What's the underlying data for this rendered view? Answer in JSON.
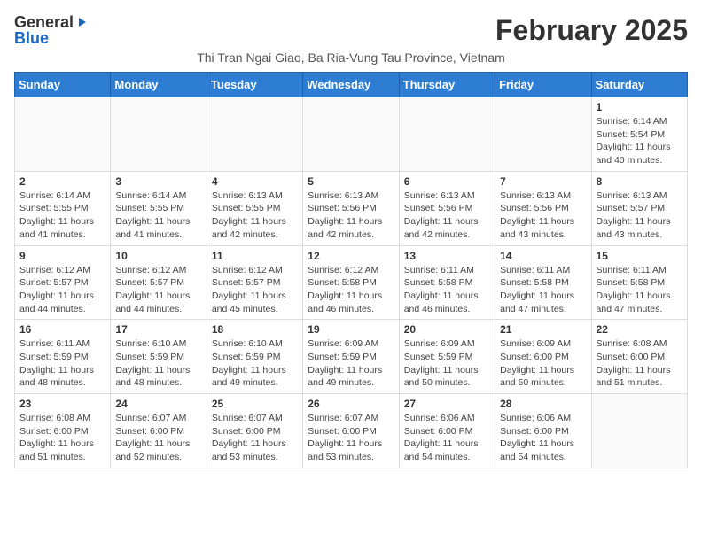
{
  "logo": {
    "general": "General",
    "blue": "Blue",
    "icon": "▶"
  },
  "title": "February 2025",
  "subtitle": "Thi Tran Ngai Giao, Ba Ria-Vung Tau Province, Vietnam",
  "days_of_week": [
    "Sunday",
    "Monday",
    "Tuesday",
    "Wednesday",
    "Thursday",
    "Friday",
    "Saturday"
  ],
  "weeks": [
    [
      {
        "num": "",
        "info": ""
      },
      {
        "num": "",
        "info": ""
      },
      {
        "num": "",
        "info": ""
      },
      {
        "num": "",
        "info": ""
      },
      {
        "num": "",
        "info": ""
      },
      {
        "num": "",
        "info": ""
      },
      {
        "num": "1",
        "info": "Sunrise: 6:14 AM\nSunset: 5:54 PM\nDaylight: 11 hours\nand 40 minutes."
      }
    ],
    [
      {
        "num": "2",
        "info": "Sunrise: 6:14 AM\nSunset: 5:55 PM\nDaylight: 11 hours\nand 41 minutes."
      },
      {
        "num": "3",
        "info": "Sunrise: 6:14 AM\nSunset: 5:55 PM\nDaylight: 11 hours\nand 41 minutes."
      },
      {
        "num": "4",
        "info": "Sunrise: 6:13 AM\nSunset: 5:55 PM\nDaylight: 11 hours\nand 42 minutes."
      },
      {
        "num": "5",
        "info": "Sunrise: 6:13 AM\nSunset: 5:56 PM\nDaylight: 11 hours\nand 42 minutes."
      },
      {
        "num": "6",
        "info": "Sunrise: 6:13 AM\nSunset: 5:56 PM\nDaylight: 11 hours\nand 42 minutes."
      },
      {
        "num": "7",
        "info": "Sunrise: 6:13 AM\nSunset: 5:56 PM\nDaylight: 11 hours\nand 43 minutes."
      },
      {
        "num": "8",
        "info": "Sunrise: 6:13 AM\nSunset: 5:57 PM\nDaylight: 11 hours\nand 43 minutes."
      }
    ],
    [
      {
        "num": "9",
        "info": "Sunrise: 6:12 AM\nSunset: 5:57 PM\nDaylight: 11 hours\nand 44 minutes."
      },
      {
        "num": "10",
        "info": "Sunrise: 6:12 AM\nSunset: 5:57 PM\nDaylight: 11 hours\nand 44 minutes."
      },
      {
        "num": "11",
        "info": "Sunrise: 6:12 AM\nSunset: 5:57 PM\nDaylight: 11 hours\nand 45 minutes."
      },
      {
        "num": "12",
        "info": "Sunrise: 6:12 AM\nSunset: 5:58 PM\nDaylight: 11 hours\nand 46 minutes."
      },
      {
        "num": "13",
        "info": "Sunrise: 6:11 AM\nSunset: 5:58 PM\nDaylight: 11 hours\nand 46 minutes."
      },
      {
        "num": "14",
        "info": "Sunrise: 6:11 AM\nSunset: 5:58 PM\nDaylight: 11 hours\nand 47 minutes."
      },
      {
        "num": "15",
        "info": "Sunrise: 6:11 AM\nSunset: 5:58 PM\nDaylight: 11 hours\nand 47 minutes."
      }
    ],
    [
      {
        "num": "16",
        "info": "Sunrise: 6:11 AM\nSunset: 5:59 PM\nDaylight: 11 hours\nand 48 minutes."
      },
      {
        "num": "17",
        "info": "Sunrise: 6:10 AM\nSunset: 5:59 PM\nDaylight: 11 hours\nand 48 minutes."
      },
      {
        "num": "18",
        "info": "Sunrise: 6:10 AM\nSunset: 5:59 PM\nDaylight: 11 hours\nand 49 minutes."
      },
      {
        "num": "19",
        "info": "Sunrise: 6:09 AM\nSunset: 5:59 PM\nDaylight: 11 hours\nand 49 minutes."
      },
      {
        "num": "20",
        "info": "Sunrise: 6:09 AM\nSunset: 5:59 PM\nDaylight: 11 hours\nand 50 minutes."
      },
      {
        "num": "21",
        "info": "Sunrise: 6:09 AM\nSunset: 6:00 PM\nDaylight: 11 hours\nand 50 minutes."
      },
      {
        "num": "22",
        "info": "Sunrise: 6:08 AM\nSunset: 6:00 PM\nDaylight: 11 hours\nand 51 minutes."
      }
    ],
    [
      {
        "num": "23",
        "info": "Sunrise: 6:08 AM\nSunset: 6:00 PM\nDaylight: 11 hours\nand 51 minutes."
      },
      {
        "num": "24",
        "info": "Sunrise: 6:07 AM\nSunset: 6:00 PM\nDaylight: 11 hours\nand 52 minutes."
      },
      {
        "num": "25",
        "info": "Sunrise: 6:07 AM\nSunset: 6:00 PM\nDaylight: 11 hours\nand 53 minutes."
      },
      {
        "num": "26",
        "info": "Sunrise: 6:07 AM\nSunset: 6:00 PM\nDaylight: 11 hours\nand 53 minutes."
      },
      {
        "num": "27",
        "info": "Sunrise: 6:06 AM\nSunset: 6:00 PM\nDaylight: 11 hours\nand 54 minutes."
      },
      {
        "num": "28",
        "info": "Sunrise: 6:06 AM\nSunset: 6:00 PM\nDaylight: 11 hours\nand 54 minutes."
      },
      {
        "num": "",
        "info": ""
      }
    ]
  ]
}
